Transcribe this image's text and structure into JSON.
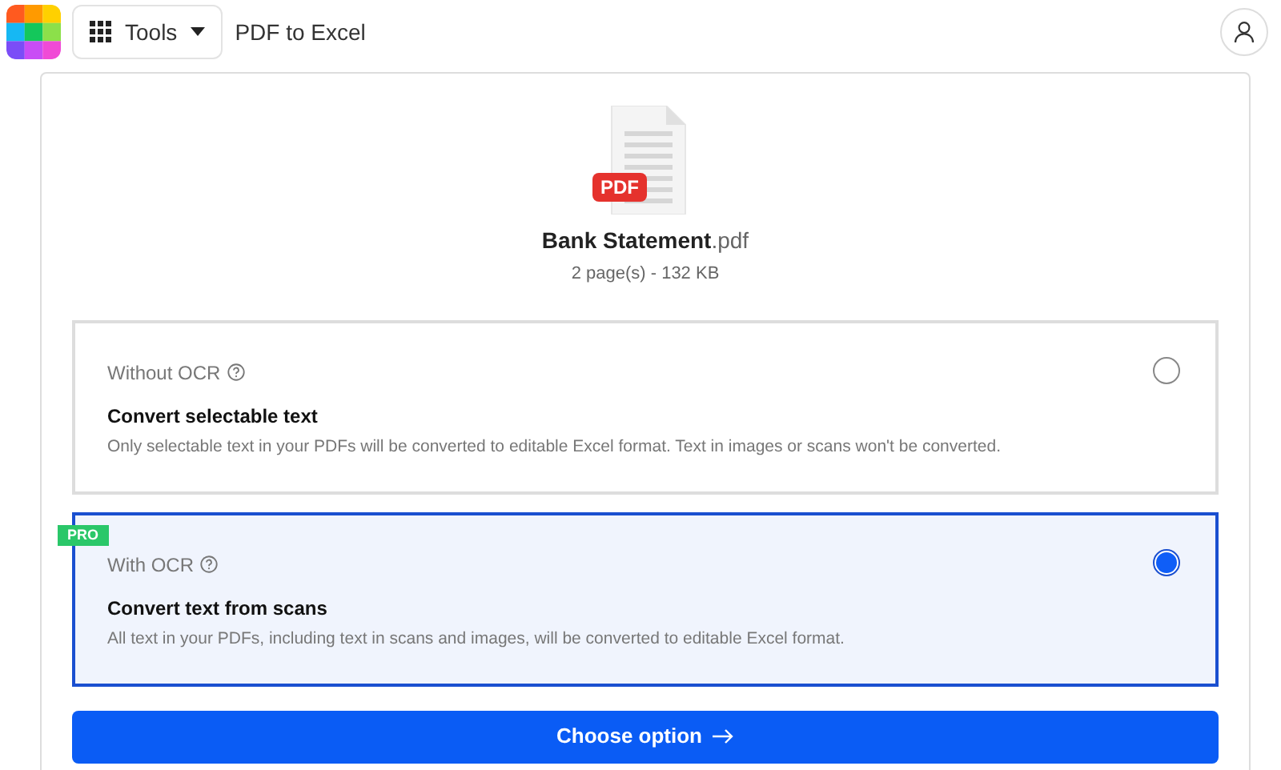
{
  "header": {
    "tools_label": "Tools",
    "page_title": "PDF to Excel"
  },
  "file": {
    "badge": "PDF",
    "name": "Bank Statement",
    "extension": ".pdf",
    "meta": "2 page(s) - 132 KB"
  },
  "options": [
    {
      "title": "Without OCR",
      "heading": "Convert selectable text",
      "description": "Only selectable text in your PDFs will be converted to editable Excel format. Text in images or scans won't be converted.",
      "selected": false
    },
    {
      "title": "With OCR",
      "heading": "Convert text from scans",
      "description": "All text in your PDFs, including text in scans and images, will be converted to editable Excel format.",
      "selected": true,
      "badge": "PRO"
    }
  ],
  "button": {
    "label": "Choose option"
  }
}
